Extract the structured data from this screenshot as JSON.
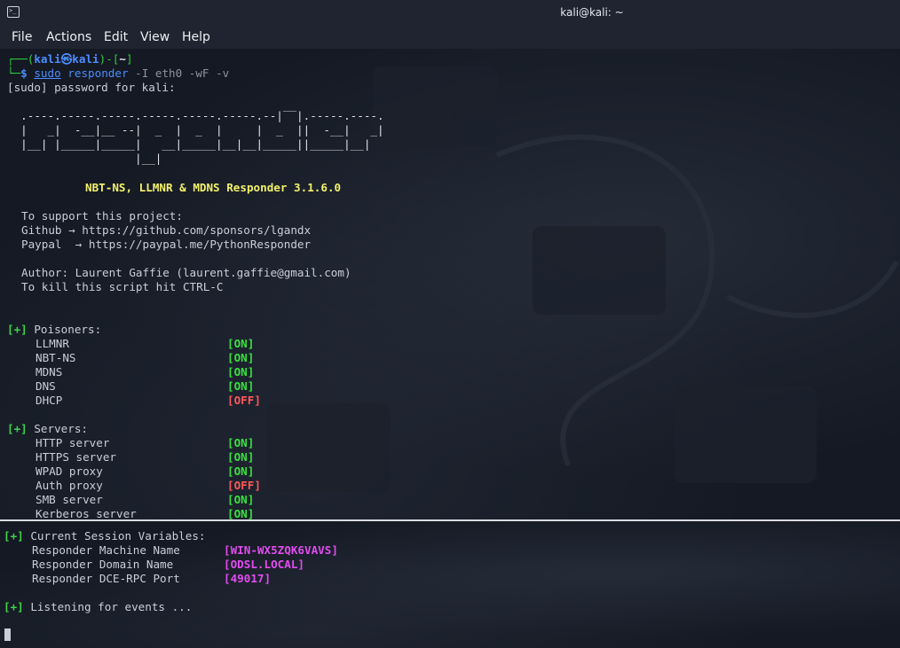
{
  "window": {
    "title": "kali@kali: ~",
    "icon": "terminal-icon"
  },
  "menu": [
    "File",
    "Actions",
    "Edit",
    "View",
    "Help"
  ],
  "prompt": {
    "corner_top": "┌──(",
    "user": "kali",
    "at": "㉿",
    "host": "kali",
    "sep": ")-[",
    "dir": "~",
    "end": "]",
    "corner_bottom": "└─",
    "dollar": "$ ",
    "cmd_sudo": "sudo",
    "cmd_prog": "responder",
    "cmd_args": " -I eth0 -wF -v"
  },
  "sudo_line": "[sudo] password for kali:",
  "banner_ascii": [
    "                                         __",
    "  .----.-----.-----.-----.-----.-----.--|  |.-----.----.",
    "  |   _|  -__|__ --|  _  |  _  |     |  _  ||  -__|   _|",
    "  |__| |_____|_____|   __|_____|__|__|_____||_____|__|",
    "                   |__|"
  ],
  "banner_title": "NBT-NS, LLMNR & MDNS Responder 3.1.6.0",
  "support": {
    "heading": "To support this project:",
    "github_label": "Github",
    "github_url": "https://github.com/sponsors/lgandx",
    "paypal_label": "Paypal",
    "paypal_url": "https://paypal.me/PythonResponder",
    "arrow": "→"
  },
  "author_line": "Author: Laurent Gaffie (laurent.gaffie@gmail.com)",
  "kill_line": "To kill this script hit CTRL-C",
  "marker": "[+]",
  "poisoners": {
    "heading": "Poisoners:",
    "items": [
      {
        "name": "LLMNR",
        "status": "[ON]"
      },
      {
        "name": "NBT-NS",
        "status": "[ON]"
      },
      {
        "name": "MDNS",
        "status": "[ON]"
      },
      {
        "name": "DNS",
        "status": "[ON]"
      },
      {
        "name": "DHCP",
        "status": "[OFF]"
      }
    ]
  },
  "servers": {
    "heading": "Servers:",
    "items": [
      {
        "name": "HTTP server",
        "status": "[ON]"
      },
      {
        "name": "HTTPS server",
        "status": "[ON]"
      },
      {
        "name": "WPAD proxy",
        "status": "[ON]"
      },
      {
        "name": "Auth proxy",
        "status": "[OFF]"
      },
      {
        "name": "SMB server",
        "status": "[ON]"
      },
      {
        "name": "Kerberos server",
        "status": "[ON]"
      }
    ]
  },
  "session": {
    "heading": "Current Session Variables:",
    "items": [
      {
        "name": "Responder Machine Name",
        "value": "[WIN-WX5ZQK6VAVS]"
      },
      {
        "name": "Responder Domain Name",
        "value": "[ODSL.LOCAL]"
      },
      {
        "name": "Responder DCE-RPC Port",
        "value": "[49017]"
      }
    ]
  },
  "listening": "Listening for events ..."
}
